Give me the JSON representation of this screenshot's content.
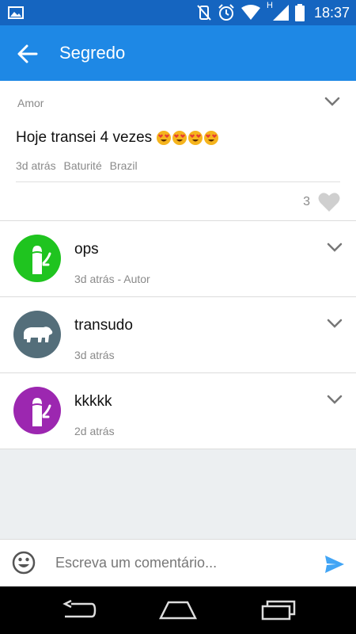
{
  "status_bar": {
    "time": "18:37",
    "network_letter": "H",
    "icons": [
      "image-icon",
      "vibrate-mute-icon",
      "alarm-icon",
      "wifi-icon",
      "signal-icon",
      "battery-icon"
    ]
  },
  "app_bar": {
    "title": "Segredo",
    "back_icon": "arrow-back-icon"
  },
  "post": {
    "category": "Amor",
    "text": "Hoje transei 4 vezes",
    "emoji_count": 4,
    "meta": {
      "time": "3d atrás",
      "city": "Baturité",
      "country": "Brazil"
    },
    "like_count": "3"
  },
  "comments": [
    {
      "name": "ops",
      "time": "3d atrás - Autor",
      "avatar_color": "#1fc41f",
      "avatar_icon": "phallus-icon"
    },
    {
      "name": "transudo",
      "time": "3d atrás",
      "avatar_color": "#546e7a",
      "avatar_icon": "bear-icon"
    },
    {
      "name": "kkkkk",
      "time": "2d atrás",
      "avatar_color": "#9c27b0",
      "avatar_icon": "phallus-icon"
    }
  ],
  "comment_input": {
    "placeholder": "Escreva um comentário..."
  },
  "colors": {
    "status_bar": "#1565c0",
    "app_bar": "#1e88e5",
    "send": "#42a5f5",
    "background": "#eceff1"
  }
}
